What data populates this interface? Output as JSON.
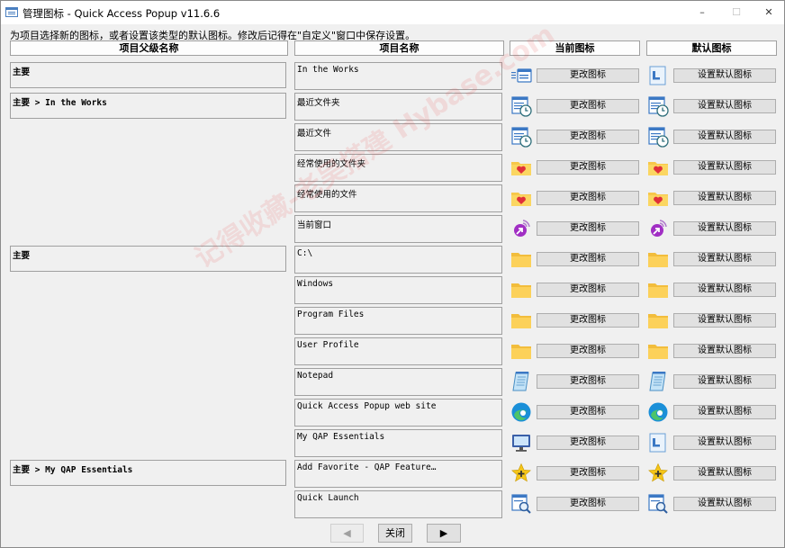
{
  "window": {
    "title": "管理图标 - Quick Access Popup v11.6.6"
  },
  "instructions": "为项目选择新的图标，或者设置该类型的默认图标。修改后记得在\"自定义\"窗口中保存设置。",
  "headers": {
    "parent": "项目父级名称",
    "name": "项目名称",
    "current": "当前图标",
    "default": "默认图标"
  },
  "parents": [
    {
      "label": "主要"
    },
    {
      "label": "主要 > In the Works"
    },
    {
      "label": "主要"
    },
    {
      "label": "主要 > My QAP Essentials"
    }
  ],
  "rows": [
    {
      "name": "In the Works",
      "current_icon": "menu-icon",
      "default_icon": "document-icon",
      "change_label": "更改图标",
      "default_label": "设置默认图标"
    },
    {
      "name": "最近文件夹",
      "current_icon": "recent-icon",
      "default_icon": "recent-icon",
      "change_label": "更改图标",
      "default_label": "设置默认图标"
    },
    {
      "name": "最近文件",
      "current_icon": "recent-icon",
      "default_icon": "recent-icon",
      "change_label": "更改图标",
      "default_label": "设置默认图标"
    },
    {
      "name": "经常使用的文件夹",
      "current_icon": "heart-folder-icon",
      "default_icon": "heart-folder-icon",
      "change_label": "更改图标",
      "default_label": "设置默认图标"
    },
    {
      "name": "经常使用的文件",
      "current_icon": "heart-folder-icon",
      "default_icon": "heart-folder-icon",
      "change_label": "更改图标",
      "default_label": "设置默认图标"
    },
    {
      "name": "当前窗口",
      "current_icon": "current-window-icon",
      "default_icon": "current-window-icon",
      "change_label": "更改图标",
      "default_label": "设置默认图标"
    },
    {
      "name": "C:\\",
      "current_icon": "folder-icon",
      "default_icon": "folder-icon",
      "change_label": "更改图标",
      "default_label": "设置默认图标"
    },
    {
      "name": "Windows",
      "current_icon": "folder-icon",
      "default_icon": "folder-icon",
      "change_label": "更改图标",
      "default_label": "设置默认图标"
    },
    {
      "name": "Program Files",
      "current_icon": "folder-icon",
      "default_icon": "folder-icon",
      "change_label": "更改图标",
      "default_label": "设置默认图标"
    },
    {
      "name": "User Profile",
      "current_icon": "folder-icon",
      "default_icon": "folder-icon",
      "change_label": "更改图标",
      "default_label": "设置默认图标"
    },
    {
      "name": "Notepad",
      "current_icon": "notepad-icon",
      "default_icon": "notepad-icon",
      "change_label": "更改图标",
      "default_label": "设置默认图标"
    },
    {
      "name": "Quick Access Popup web site",
      "current_icon": "edge-icon",
      "default_icon": "edge-icon",
      "change_label": "更改图标",
      "default_label": "设置默认图标"
    },
    {
      "name": "My QAP Essentials",
      "current_icon": "monitor-icon",
      "default_icon": "document-icon",
      "change_label": "更改图标",
      "default_label": "设置默认图标"
    },
    {
      "name": "Add Favorite - QAP Feature…",
      "current_icon": "star-add-icon",
      "default_icon": "star-add-icon",
      "change_label": "更改图标",
      "default_label": "设置默认图标"
    },
    {
      "name": "Quick Launch",
      "current_icon": "search-doc-icon",
      "default_icon": "search-doc-icon",
      "change_label": "更改图标",
      "default_label": "设置默认图标"
    }
  ],
  "nav": {
    "prev": "◀",
    "close": "关闭",
    "next": "▶"
  },
  "watermark": "记得收藏-老吴搭建 Hybase.com"
}
